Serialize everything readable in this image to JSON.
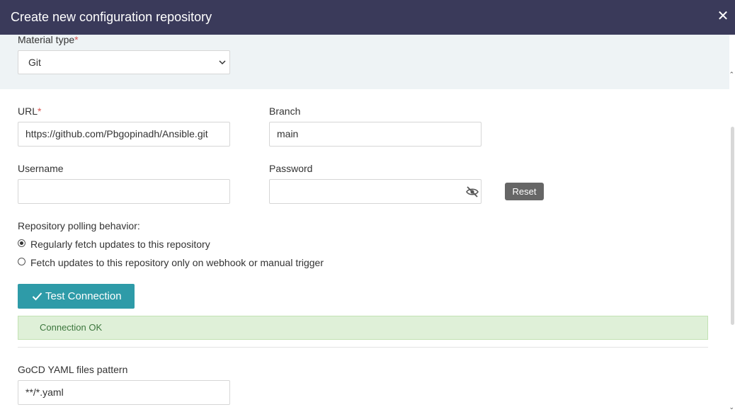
{
  "dialog": {
    "title": "Create new configuration repository",
    "close_icon": "close-icon"
  },
  "material_type": {
    "label": "Material type",
    "required_mark": "*",
    "value": "Git"
  },
  "url": {
    "label": "URL",
    "required_mark": "*",
    "value": "https://github.com/Pbgopinadh/Ansible.git"
  },
  "branch": {
    "label": "Branch",
    "value": "main"
  },
  "username": {
    "label": "Username",
    "value": ""
  },
  "password": {
    "label": "Password",
    "value": "",
    "toggle_icon": "eye-slash-icon",
    "reset_label": "Reset"
  },
  "polling": {
    "label": "Repository polling behavior:",
    "options": [
      {
        "label": "Regularly fetch updates to this repository",
        "checked": true
      },
      {
        "label": "Fetch updates to this repository only on webhook or manual trigger",
        "checked": false
      }
    ]
  },
  "test_connection": {
    "label": "Test Connection",
    "icon": "check-icon"
  },
  "connection_status": {
    "message": "Connection OK"
  },
  "yaml_pattern": {
    "label": "GoCD YAML files pattern",
    "value": "**/*.yaml"
  },
  "colors": {
    "header_bg": "#3a3a5a",
    "band_bg": "#eef3f5",
    "required": "#d9534f",
    "primary_button": "#2e9ba8",
    "success_bg": "#dff0d8",
    "success_text": "#3c763d"
  }
}
